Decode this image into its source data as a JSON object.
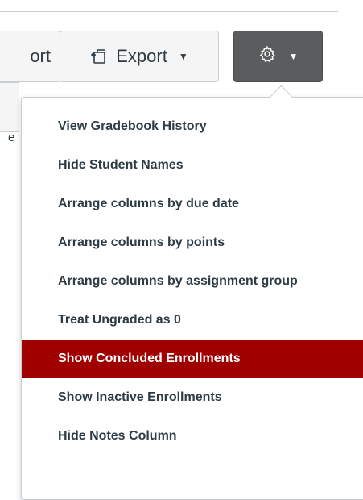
{
  "toolbar": {
    "import_label": "Import",
    "import_visible_fragment": "ort",
    "export_label": "Export",
    "settings_icon": "gear-icon",
    "export_icon": "export-icon",
    "caret_icon": "caret-down-icon"
  },
  "grid": {
    "header_fragment": "e"
  },
  "menu": {
    "items": [
      {
        "label": "View Gradebook History",
        "active": false
      },
      {
        "label": "Hide Student Names",
        "active": false
      },
      {
        "label": "Arrange columns by due date",
        "active": false
      },
      {
        "label": "Arrange columns by points",
        "active": false
      },
      {
        "label": "Arrange columns by assignment group",
        "active": false
      },
      {
        "label": "Treat Ungraded as 0",
        "active": false
      },
      {
        "label": "Show Concluded Enrollments",
        "active": true
      },
      {
        "label": "Show Inactive Enrollments",
        "active": false
      },
      {
        "label": "Hide Notes Column",
        "active": false
      }
    ]
  },
  "colors": {
    "accent_active": "#a00000",
    "settings_button_bg": "#5a5c5d",
    "text": "#2d3b45",
    "border": "#c7cdd1"
  }
}
